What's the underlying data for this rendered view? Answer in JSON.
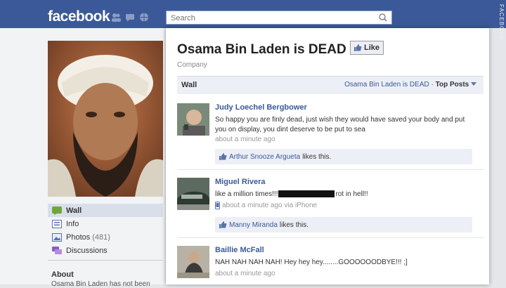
{
  "topbar": {
    "logo": "facebook",
    "search_placeholder": "Search",
    "watermark": "FACEBOOK"
  },
  "page": {
    "title": "Osama Bin Laden is DEAD",
    "like_label": "Like",
    "category": "Company"
  },
  "leftnav": {
    "items": [
      {
        "label": "Wall",
        "count": ""
      },
      {
        "label": "Info",
        "count": ""
      },
      {
        "label": "Photos",
        "count": "(481)"
      },
      {
        "label": "Discussions",
        "count": ""
      }
    ],
    "about_title": "About",
    "about_text": "Osama Bin Laden has not been"
  },
  "wall": {
    "label": "Wall",
    "filter_page": "Osama Bin Laden is DEAD",
    "filter_sep": "·",
    "filter_sort": "Top Posts"
  },
  "posts": [
    {
      "author": "Judy Loechel Bergbower",
      "message": "So happy you are finly dead, just wish they would have saved your body and put you on display, you dint deserve to be put to sea",
      "time": "about a minute ago",
      "liker": "Arthur Snooze Argueta",
      "likes_suffix": "likes this."
    },
    {
      "author": "Miguel Rivera",
      "message_before": "like a million times!!!",
      "message_after": "rot in hell!!",
      "time": "about a minute ago via iPhone",
      "liker": "Manny Miranda",
      "likes_suffix": "likes this."
    },
    {
      "author": "Baillie McFall",
      "message": "NAH NAH NAH NAH! Hey hey hey........GOOOOOODBYE!!! ;]",
      "time": "about a minute ago"
    }
  ],
  "colors": {
    "brand_blue": "#3b5998",
    "link_blue": "#3b5998",
    "like_bg": "#eceff5"
  }
}
